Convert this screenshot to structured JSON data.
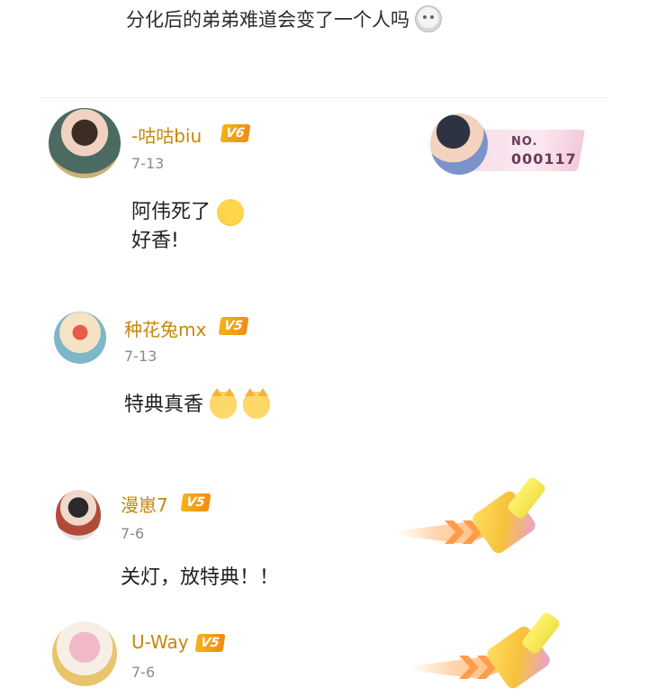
{
  "post": {
    "title": "分化后的弟弟难道会变了一个人吗",
    "title_emoji": "sweat-face-icon"
  },
  "comments": [
    {
      "username": "-咕咕biu",
      "level": "V6",
      "date": "7-13",
      "lines": [
        "阿伟死了",
        "好香!"
      ],
      "line_emojis": [
        "face-covering-eyes-icon"
      ],
      "card": {
        "label": "NO.",
        "number": "000117"
      }
    },
    {
      "username": "种花兔mx",
      "level": "V5",
      "date": "7-13",
      "text": "特典真香",
      "emojis": [
        "cat-face-icon",
        "cat-face-icon"
      ]
    },
    {
      "username": "漫崽7",
      "level": "V5",
      "date": "7-6",
      "text": "关灯，放特典！！",
      "decoration": "paint-brush-icon"
    },
    {
      "username": "U-Way",
      "level": "V5",
      "date": "7-6",
      "decoration": "paint-brush-icon"
    }
  ],
  "colors": {
    "username": "#c8860b",
    "badge": "#f5a218",
    "date": "#8a8a8a"
  }
}
